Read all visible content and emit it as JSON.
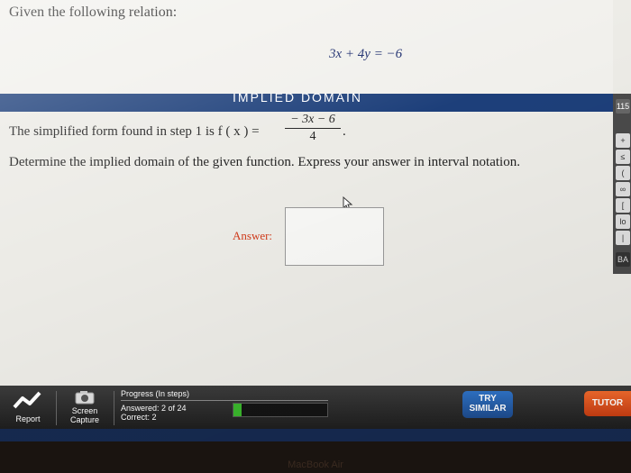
{
  "question": {
    "title": "Given the following relation:",
    "equation": "3x + 4y = −6"
  },
  "section": {
    "title": "IMPLIED DOMAIN"
  },
  "step": {
    "text": "The simplified form found in step 1 is f ( x ) =",
    "numerator": "− 3x − 6",
    "denominator": "4",
    "period": "."
  },
  "instruction": "Determine the implied domain of the given function. Express your answer in interval notation.",
  "answer": {
    "label": "Answer:",
    "value": ""
  },
  "toolbar": {
    "report_label": "Report",
    "screen_capture_label": "Screen Capture",
    "progress_title": "Progress (In steps)",
    "answered_text": "Answered: 2 of 24",
    "correct_text": "Correct:    2",
    "progress_fraction": 0.083,
    "try_similar_label": "TRY SIMILAR",
    "tutor_label": "TUTOR"
  },
  "side_strip": {
    "items": [
      "115",
      "+",
      "≤",
      "(",
      "∞",
      "[",
      "lo",
      "|",
      "BA"
    ]
  },
  "laptop": {
    "brand": "MacBook Air"
  },
  "colors": {
    "section_bar": "#1d3f7a",
    "answer_label": "#d03a1a",
    "progress_fill": "#3ab52c",
    "try_similar": "#2f73c7",
    "tutor": "#f26a2c"
  }
}
